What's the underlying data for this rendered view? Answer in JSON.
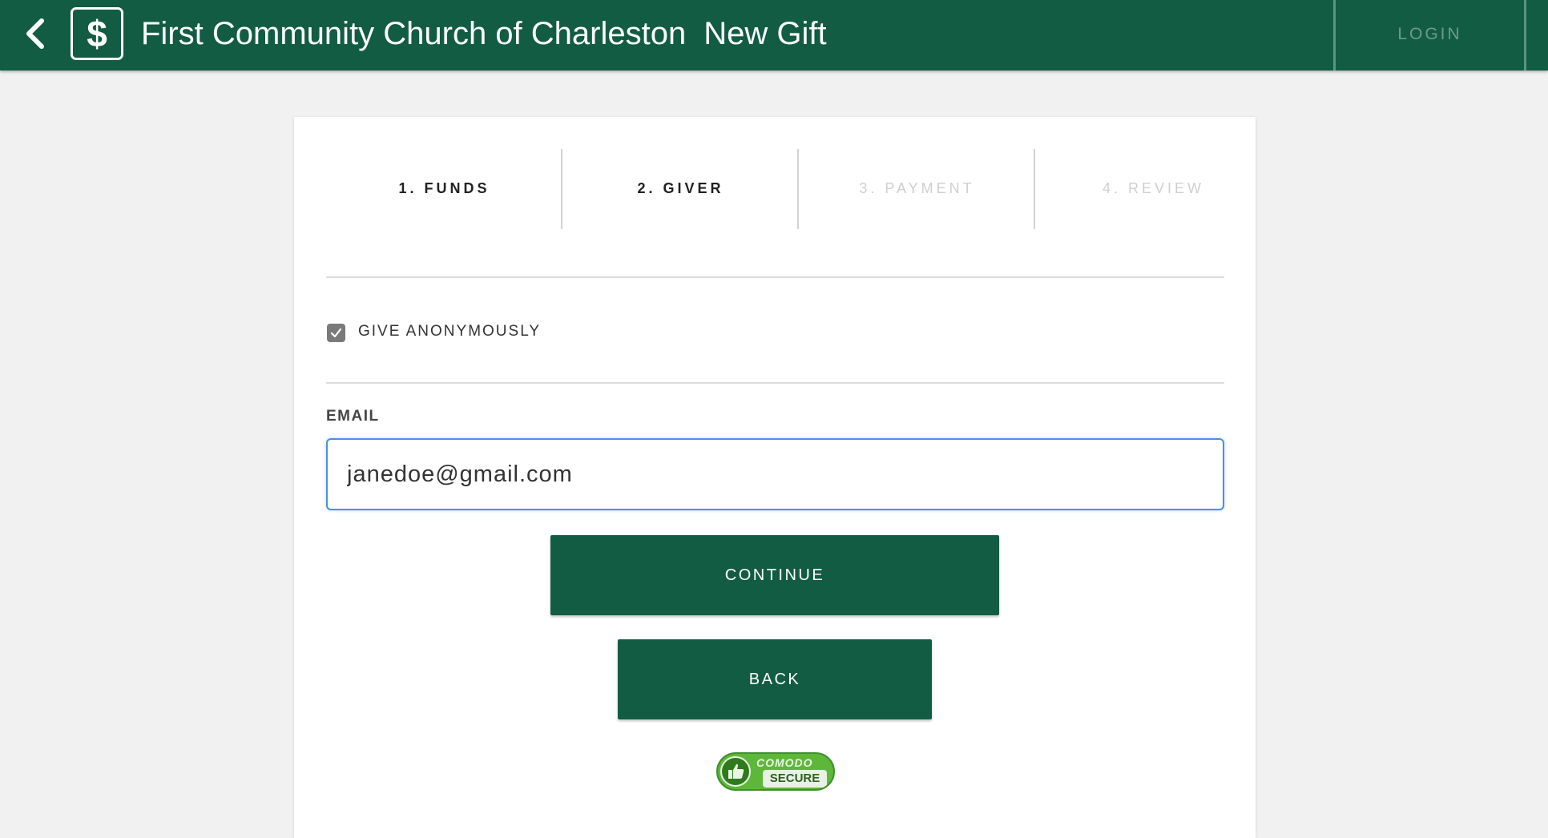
{
  "header": {
    "org_name": "First Community Church of Charleston",
    "page_title": "New Gift",
    "logo_symbol": "$",
    "login_label": "LOGIN",
    "back_icon": "chevron-left-icon"
  },
  "steps": [
    {
      "label": "1. FUNDS",
      "state": "complete"
    },
    {
      "label": "2. GIVER",
      "state": "current"
    },
    {
      "label": "3. PAYMENT",
      "state": "disabled"
    },
    {
      "label": "4. REVIEW",
      "state": "disabled"
    }
  ],
  "giver": {
    "anonymous_label": "GIVE ANONYMOUSLY",
    "anonymous_checked": true,
    "email_label": "EMAIL",
    "email_value": "janedoe@gmail.com"
  },
  "actions": {
    "continue_label": "CONTINUE",
    "back_label": "BACK"
  },
  "security_badge": {
    "top": "COMODO",
    "bottom": "SECURE"
  },
  "colors": {
    "brand": "#125c43",
    "page_bg": "#f1f1f1",
    "focus_border": "#4a90e2"
  }
}
